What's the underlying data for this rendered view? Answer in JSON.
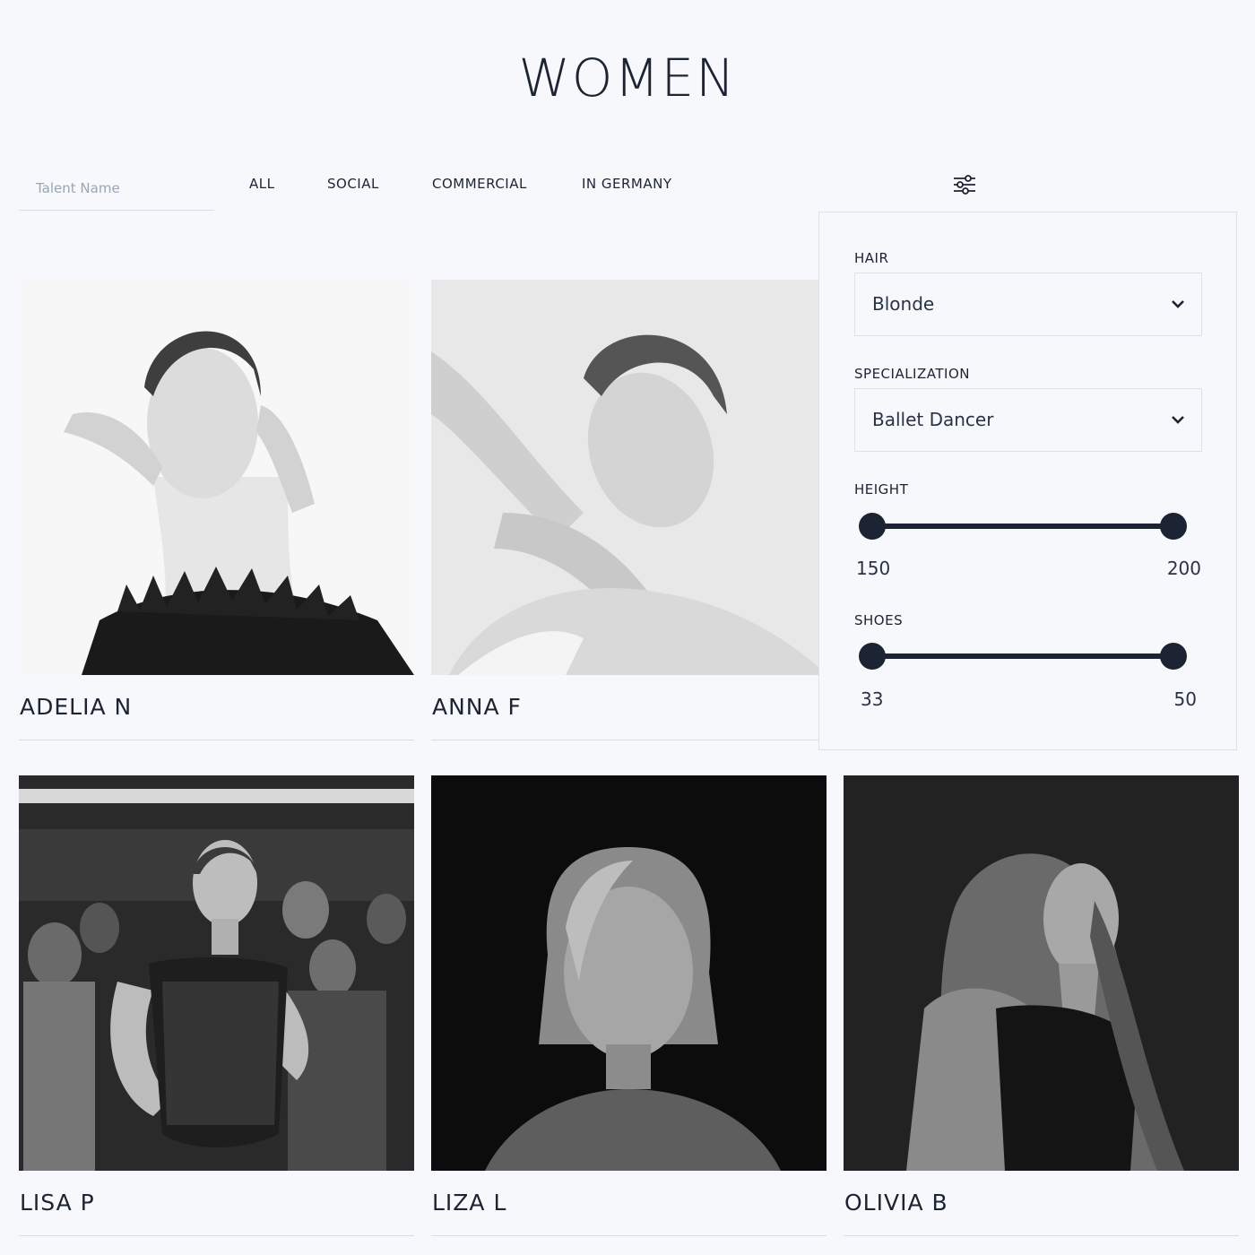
{
  "page": {
    "title": "WOMEN"
  },
  "search": {
    "placeholder": "Talent Name"
  },
  "tabs": [
    {
      "label": "ALL"
    },
    {
      "label": "SOCIAL"
    },
    {
      "label": "COMMERCIAL"
    },
    {
      "label": "IN GERMANY"
    }
  ],
  "filter_toggle_icon": "sliders-icon",
  "talents": [
    {
      "name": "ADELIA N"
    },
    {
      "name": "ANNA F"
    },
    {
      "name": "LISA P"
    },
    {
      "name": "LIZA L"
    },
    {
      "name": "OLIVIA B"
    }
  ],
  "filters": {
    "hair": {
      "label": "HAIR",
      "value": "Blonde"
    },
    "specialization": {
      "label": "SPECIALIZATION",
      "value": "Ballet Dancer"
    },
    "height": {
      "label": "HEIGHT",
      "min": "150",
      "max": "200"
    },
    "shoes": {
      "label": "SHOES",
      "min": "33",
      "max": "50"
    }
  },
  "colors": {
    "background": "#f6f8fb",
    "text": "#1c2433",
    "accent": "#1c2433",
    "border": "#dde2ea"
  }
}
